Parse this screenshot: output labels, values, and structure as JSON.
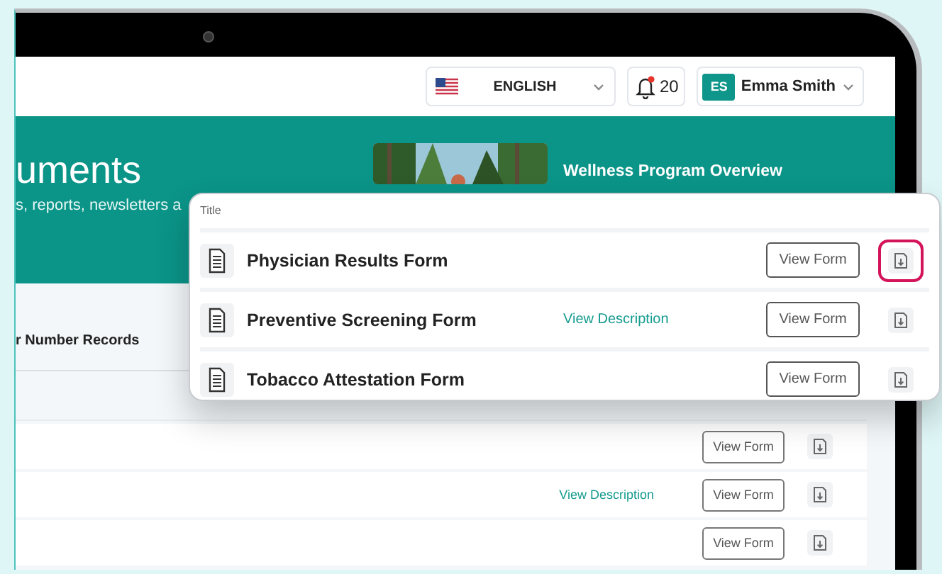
{
  "header": {
    "language": "ENGLISH",
    "notifications": "20",
    "user": {
      "initials": "ES",
      "name": "Emma Smith"
    }
  },
  "banner": {
    "title": "uments",
    "subtitle": "s, reports, newsletters a",
    "feature": {
      "kind": "picture",
      "title": "Wellness Program Overview"
    }
  },
  "records": {
    "heading": "r Number Records",
    "rows": [
      {
        "action": "View Form"
      },
      {
        "link": "View Description",
        "action": "View Form"
      },
      {
        "action": "View Form"
      }
    ]
  },
  "popup": {
    "column": "Title",
    "rows": [
      {
        "title": "Physician Results Form",
        "action": "View Form",
        "highlighted": true
      },
      {
        "title": "Preventive Screening Form",
        "link": "View Description",
        "action": "View Form",
        "highlighted": false
      },
      {
        "title": "Tobacco Attestation Form",
        "action": "View Form",
        "highlighted": false
      }
    ]
  }
}
